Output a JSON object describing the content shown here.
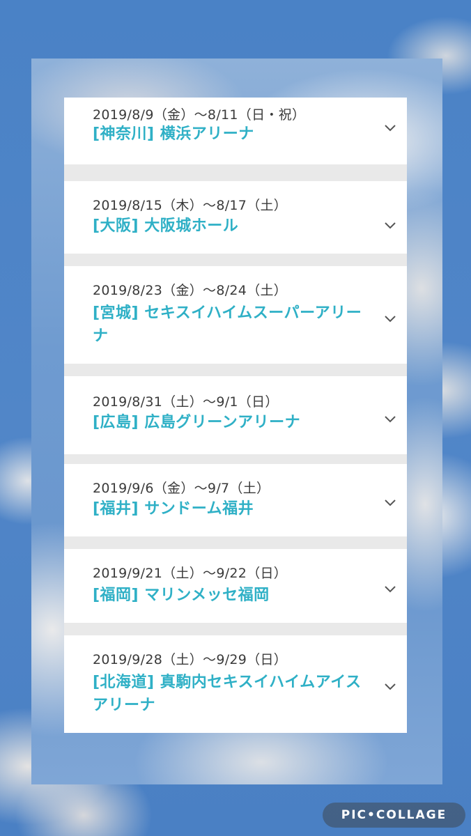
{
  "watermark": "PIC•COLLAGE",
  "colors": {
    "venue": "#2fb0c6",
    "date": "#3a3a3a",
    "card": "#ffffff",
    "sky": "#4a82c6"
  },
  "events": [
    {
      "date": "2019/8/9（金）～8/11（日・祝）",
      "venue": "[神奈川] 横浜アリーナ",
      "icon": "chevron-down-icon"
    },
    {
      "date": "2019/8/15（木）～8/17（土）",
      "venue": "[大阪] 大阪城ホール",
      "icon": "chevron-down-icon"
    },
    {
      "date": "2019/8/23（金）～8/24（土）",
      "venue": "[宮城] セキスイハイムスーパーアリーナ",
      "icon": "chevron-down-icon"
    },
    {
      "date": "2019/8/31（土）～9/1（日）",
      "venue": "[広島] 広島グリーンアリーナ",
      "icon": "chevron-down-icon"
    },
    {
      "date": "2019/9/6（金）～9/7（土）",
      "venue": "[福井] サンドーム福井",
      "icon": "chevron-down-icon"
    },
    {
      "date": "2019/9/21（土）～9/22（日）",
      "venue": "[福岡] マリンメッセ福岡",
      "icon": "chevron-down-icon"
    },
    {
      "date": "2019/9/28（土）～9/29（日）",
      "venue": "[北海道] 真駒内セキスイハイムアイスアリーナ",
      "icon": "chevron-down-icon"
    }
  ]
}
